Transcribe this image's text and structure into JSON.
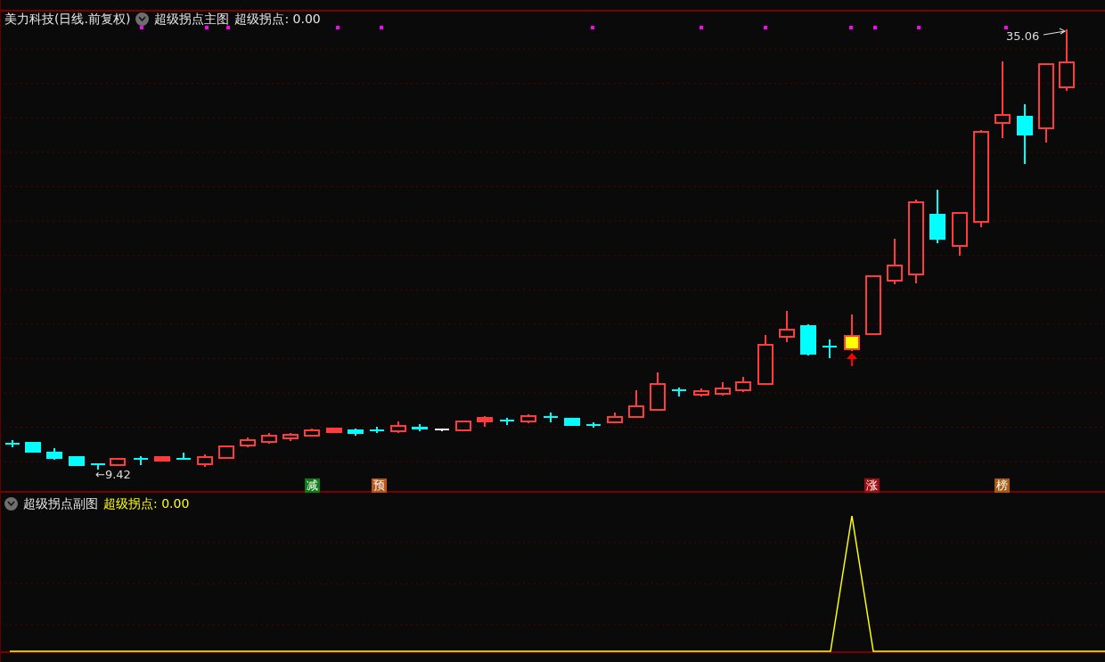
{
  "main_panel": {
    "title": "美力科技(日线.前复权)",
    "indicator_name": "超级拐点主图",
    "indicator_value": "超级拐点: 0.00",
    "high_label": "35.06",
    "low_label": "←9.42",
    "signals": [
      {
        "text": "减",
        "color": "#0e7d14"
      },
      {
        "text": "预",
        "color": "#b8561a"
      },
      {
        "text": "涨",
        "color": "#a01010"
      },
      {
        "text": "榜",
        "color": "#a85a10"
      }
    ]
  },
  "sub_panel": {
    "indicator_name": "超级拐点副图",
    "indicator_value": "超级拐点: 0.00"
  }
}
